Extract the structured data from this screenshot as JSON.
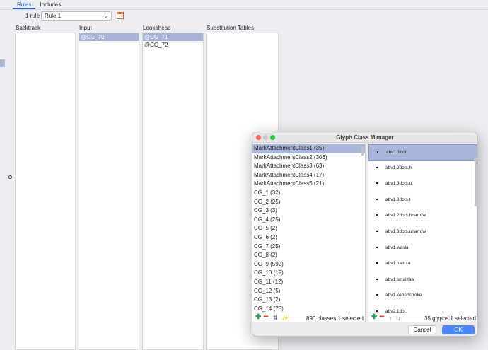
{
  "tabs": [
    {
      "label": "Rules",
      "active": true
    },
    {
      "label": "Includes",
      "active": false
    }
  ],
  "rule_bar": {
    "count_label": "1 rule",
    "selected_rule": "Rule 1"
  },
  "columns": {
    "backtrack": {
      "label": "Backtrack",
      "items": []
    },
    "input": {
      "label": "Input",
      "items": [
        "@CG_70"
      ],
      "selected": 0
    },
    "lookahead": {
      "label": "Lookahead",
      "items": [
        "@CG_71",
        "@CG_72"
      ],
      "selected": 0
    },
    "substitution": {
      "label": "Substitution Tables",
      "items": []
    }
  },
  "dialog": {
    "title": "Glyph Class Manager",
    "classes": [
      "MarkAttachmentClass1 (35)",
      "MarkAttachmentClass2 (306)",
      "MarkAttachmentClass3 (63)",
      "MarkAttachmentClass4 (17)",
      "MarkAttachmentClass5 (21)",
      "CG_1 (32)",
      "CG_2 (25)",
      "CG_3 (3)",
      "CG_4 (25)",
      "CG_5 (2)",
      "CG_6 (2)",
      "CG_7 (25)",
      "CG_8 (2)",
      "CG_9 (592)",
      "CG_10 (12)",
      "CG_11 (12)",
      "CG_12 (5)",
      "CG_13 (2)",
      "CG_14 (75)"
    ],
    "selected_class": 0,
    "glyphs": [
      "abv1.1dot",
      "abv1.2dots.h",
      "abv1.3dots.u",
      "abv1.3dots.t",
      "abv1.2dots.hnarrow",
      "abv1.3dots.unarrow",
      "abv1.wasla",
      "abv1.hamza",
      "abv1.smalltaa",
      "abv1.kehehstroke",
      "abv2.1dot"
    ],
    "selected_glyph": 0,
    "classes_status": "890 classes 1 selected",
    "glyphs_status": "35 glyphs 1 selected",
    "cancel_label": "Cancel",
    "ok_label": "OK"
  },
  "colors": {
    "accent": "#2b62d9",
    "selection": "#a8b6db",
    "ok_button": "#4a86f7",
    "add_icon": "#2ea04f",
    "remove_icon": "#d6452f"
  },
  "icons": [
    "calendar-icon",
    "add-icon",
    "remove-icon",
    "sort-icon",
    "magic-wand-icon",
    "move-up-icon",
    "move-down-icon"
  ]
}
